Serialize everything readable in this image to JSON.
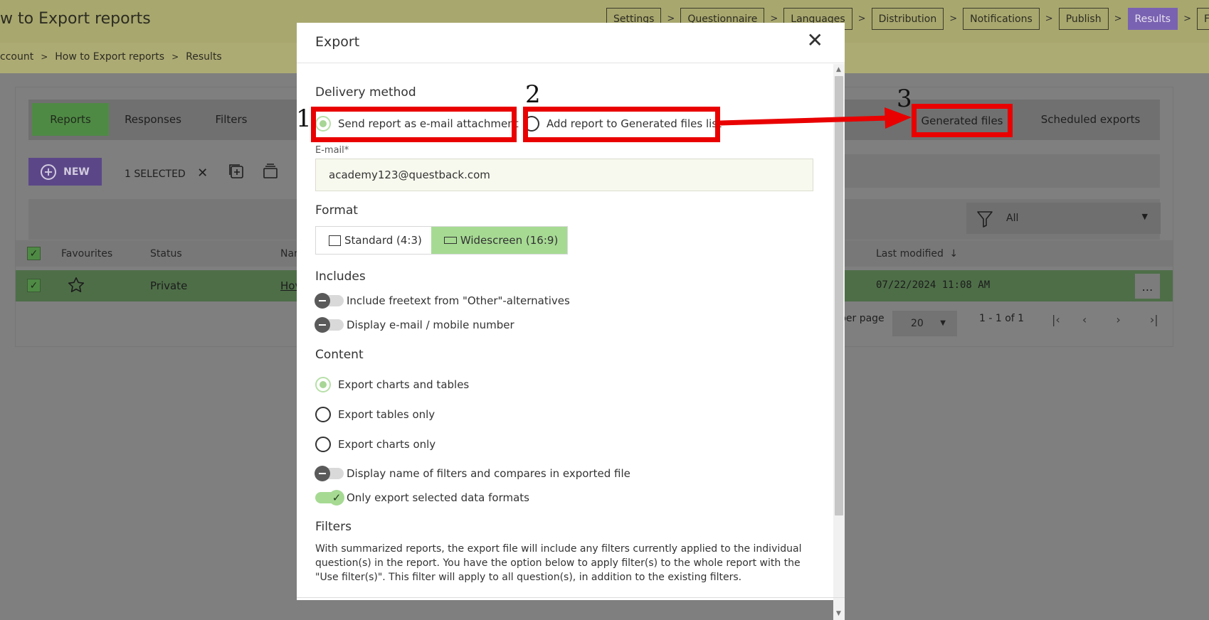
{
  "app": {
    "title": "w to Export reports",
    "steps": [
      "Settings",
      "Questionnaire",
      "Languages",
      "Distribution",
      "Notifications",
      "Publish",
      "Results",
      "Follow-"
    ],
    "active_step": "Results",
    "breadcrumb": [
      "ccount",
      "How to Export reports",
      "Results"
    ]
  },
  "tabs": {
    "reports": "Reports",
    "responses": "Responses",
    "filters": "Filters",
    "generated_files": "Generated files",
    "scheduled_exports": "Scheduled exports"
  },
  "toolbar": {
    "new_label": "NEW",
    "selected_label": "1 SELECTED"
  },
  "filter_select": {
    "value": "All"
  },
  "table": {
    "headers": {
      "favourites": "Favourites",
      "status": "Status",
      "name": "Nar",
      "last_modified": "Last modified"
    },
    "row": {
      "status": "Private",
      "name": "Hov",
      "last_modified": "07/22/2024 11:08 AM"
    }
  },
  "pagination": {
    "per_page_label": "per page",
    "per_page_value": "20",
    "range": "1 - 1 of 1"
  },
  "modal": {
    "title": "Export",
    "delivery_method": {
      "heading": "Delivery method",
      "option_email": "Send report as e-mail attachment",
      "option_generated": "Add report to Generated files list",
      "selected": "email"
    },
    "email": {
      "label": "E-mail*",
      "value": "academy123@questback.com"
    },
    "format": {
      "heading": "Format",
      "standard": "Standard (4:3)",
      "widescreen": "Widescreen (16:9)",
      "selected": "widescreen"
    },
    "includes": {
      "heading": "Includes",
      "freetext": "Include freetext from \"Other\"-alternatives",
      "email_mobile": "Display e-mail / mobile number"
    },
    "content": {
      "heading": "Content",
      "charts_tables": "Export charts and tables",
      "tables_only": "Export tables only",
      "charts_only": "Export charts only",
      "display_filter_names": "Display name of filters and compares in exported file",
      "only_selected_formats": "Only export selected data formats",
      "only_selected_formats_on": true
    },
    "filters": {
      "heading": "Filters",
      "description": "With summarized reports, the export file will include any filters currently applied to the individual question(s) in the report. You have the option below to apply filter(s) to the whole report with the \"Use filter(s)\". This filter will apply to all question(s), in addition to the existing filters."
    }
  },
  "annotations": {
    "numbers": [
      "1",
      "2",
      "3"
    ],
    "color": "#e90000"
  }
}
